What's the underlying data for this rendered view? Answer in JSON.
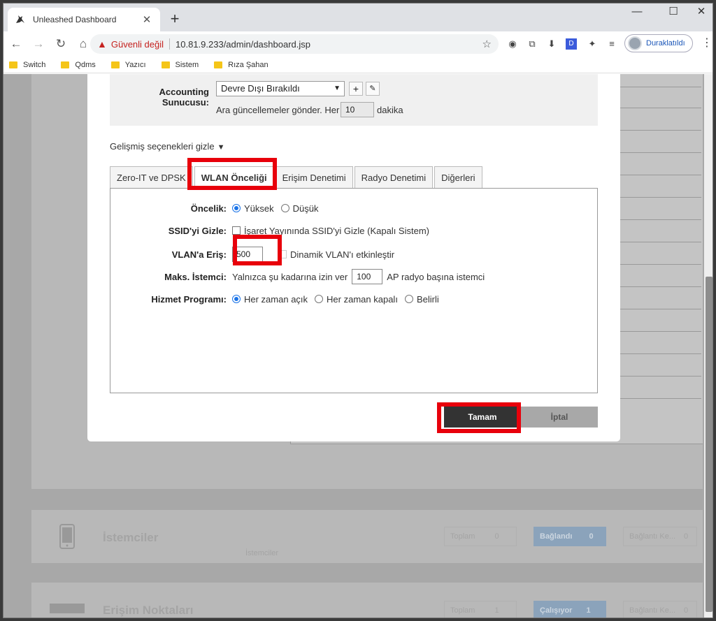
{
  "browser": {
    "tab_title": "Unleashed Dashboard",
    "tab_close": "✕",
    "new_tab": "+",
    "security_label": "Güvenli değil",
    "url": "10.81.9.233/admin/dashboard.jsp",
    "profile_label": "Duraklatıldı",
    "bookmarks": [
      {
        "label": "Switch"
      },
      {
        "label": "Qdms"
      },
      {
        "label": "Yazıcı"
      },
      {
        "label": "Sistem"
      },
      {
        "label": "Rıza Şahan"
      }
    ]
  },
  "dialog": {
    "accounting_label": "Accounting Sunucusu:",
    "accounting_value": "Devre Dışı Bırakıldı",
    "updates_prefix": "Ara güncellemeler gönder. Her",
    "updates_value": "10",
    "updates_suffix": "dakika",
    "advanced_toggle": "Gelişmiş seçenekleri gizle",
    "tabs": [
      {
        "label": "Zero-IT ve DPSK"
      },
      {
        "label": "WLAN Önceliği"
      },
      {
        "label": "Erişim Denetimi"
      },
      {
        "label": "Radyo Denetimi"
      },
      {
        "label": "Diğerleri"
      }
    ],
    "priority": {
      "label": "Öncelik:",
      "opt_high": "Yüksek",
      "opt_low": "Düşük"
    },
    "ssid": {
      "label": "SSID'yi Gizle:",
      "text": "İşaret Yayınında SSID'yi Gizle (Kapalı Sistem)"
    },
    "vlan": {
      "label": "VLAN'a Eriş:",
      "value": "500",
      "text": "Dinamik VLAN'ı etkinleştir"
    },
    "max_clients": {
      "label": "Maks. İstemci:",
      "prefix": "Yalnızca şu kadarına izin ver",
      "value": "100",
      "suffix": "AP radyo başına istemci"
    },
    "schedule": {
      "label": "Hizmet Programı:",
      "opt_on": "Her zaman açık",
      "opt_off": "Her zaman kapalı",
      "opt_specific": "Belirli"
    },
    "ok_label": "Tamam",
    "cancel_label": "İptal"
  },
  "background": {
    "clients_title": "İstemciler",
    "clients_sub": "İstemciler",
    "clients_total_label": "Toplam",
    "clients_total": "0",
    "clients_connected_label": "Bağlandı",
    "clients_connected": "0",
    "clients_disconnected_label": "Bağlantı Ke...",
    "clients_disconnected": "0",
    "ap_title": "Erişim Noktaları",
    "ap_total_label": "Toplam",
    "ap_total": "1",
    "ap_running_label": "Çalışıyor",
    "ap_running": "1",
    "ap_disconnected_label": "Bağlantı Ke...",
    "ap_disconnected": "0"
  },
  "colors": {
    "highlight": "#e8000b",
    "accent": "#1a73e8"
  }
}
